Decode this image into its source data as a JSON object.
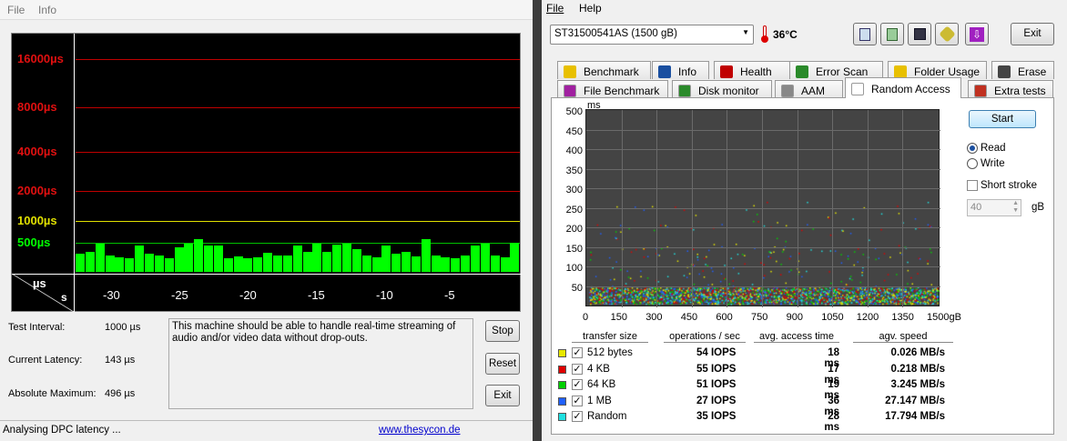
{
  "left": {
    "menu": {
      "file": "File",
      "info": "Info"
    },
    "y_labels": [
      {
        "text": "16000µs",
        "color": "#e01010"
      },
      {
        "text": "8000µs",
        "color": "#e01010"
      },
      {
        "text": "4000µs",
        "color": "#e01010"
      },
      {
        "text": "2000µs",
        "color": "#e01010"
      },
      {
        "text": "1000µs",
        "color": "#e0e000"
      },
      {
        "text": "500µs",
        "color": "#00ff00"
      }
    ],
    "axis_unit_top": "µs",
    "axis_unit_bottom": "s",
    "x_ticks": [
      "-30",
      "-25",
      "-20",
      "-15",
      "-10",
      "-5"
    ],
    "latency_bars": [
      0.55,
      0.62,
      0.85,
      0.5,
      0.45,
      0.42,
      0.8,
      0.55,
      0.5,
      0.42,
      0.75,
      0.85,
      1.0,
      0.8,
      0.8,
      0.42,
      0.48,
      0.42,
      0.45,
      0.58,
      0.5,
      0.5,
      0.8,
      0.62,
      0.85,
      0.62,
      0.82,
      0.85,
      0.7,
      0.5,
      0.45,
      0.8,
      0.55,
      0.62,
      0.48,
      1.0,
      0.5,
      0.45,
      0.42,
      0.5,
      0.8,
      0.85,
      0.5,
      0.45,
      0.9
    ],
    "test_interval_label": "Test Interval:",
    "test_interval_value": "1000 µs",
    "current_latency_label": "Current Latency:",
    "current_latency_value": "143 µs",
    "absolute_max_label": "Absolute Maximum:",
    "absolute_max_value": "496 µs",
    "message": "This machine should be able to handle real-time streaming of audio and/or video data without drop-outs.",
    "stop_label": "Stop",
    "reset_label": "Reset",
    "exit_label": "Exit",
    "status": "Analysing DPC latency ...",
    "link": "www.thesycon.de"
  },
  "right": {
    "menu": {
      "file": "File",
      "help": "Help"
    },
    "drive": "ST31500541AS (1500 gB)",
    "temperature": "36°C",
    "exit_label": "Exit",
    "tabs_row1": [
      "Benchmark",
      "Info",
      "Health",
      "Error Scan",
      "Folder Usage",
      "Erase"
    ],
    "tabs_row2": [
      "File Benchmark",
      "Disk monitor",
      "AAM",
      "Random Access",
      "Extra tests"
    ],
    "start_label": "Start",
    "read_label": "Read",
    "write_label": "Write",
    "short_stroke_label": "Short stroke",
    "stroke_value": "40",
    "stroke_unit": "gB",
    "y_unit": "ms",
    "y_ticks": [
      "500",
      "450",
      "400",
      "350",
      "300",
      "250",
      "200",
      "150",
      "100",
      "50"
    ],
    "x_ticks": [
      "0",
      "150",
      "300",
      "450",
      "600",
      "750",
      "900",
      "1050",
      "1200",
      "1350",
      "1500gB"
    ],
    "table_headers": [
      "transfer size",
      "operations / sec",
      "avg. access time",
      "agv. speed"
    ],
    "rows": [
      {
        "color": "#e8e800",
        "size": "512 bytes",
        "iops": "54 IOPS",
        "time": "18 ms",
        "speed": "0.026 MB/s"
      },
      {
        "color": "#e00000",
        "size": "4 KB",
        "iops": "55 IOPS",
        "time": "17 ms",
        "speed": "0.218 MB/s"
      },
      {
        "color": "#00d000",
        "size": "64 KB",
        "iops": "51 IOPS",
        "time": "19 ms",
        "speed": "3.245 MB/s"
      },
      {
        "color": "#2060ff",
        "size": "1 MB",
        "iops": "27 IOPS",
        "time": "36 ms",
        "speed": "27.147 MB/s"
      },
      {
        "color": "#20e0e0",
        "size": "Random",
        "iops": "35 IOPS",
        "time": "28 ms",
        "speed": "17.794 MB/s"
      }
    ]
  }
}
